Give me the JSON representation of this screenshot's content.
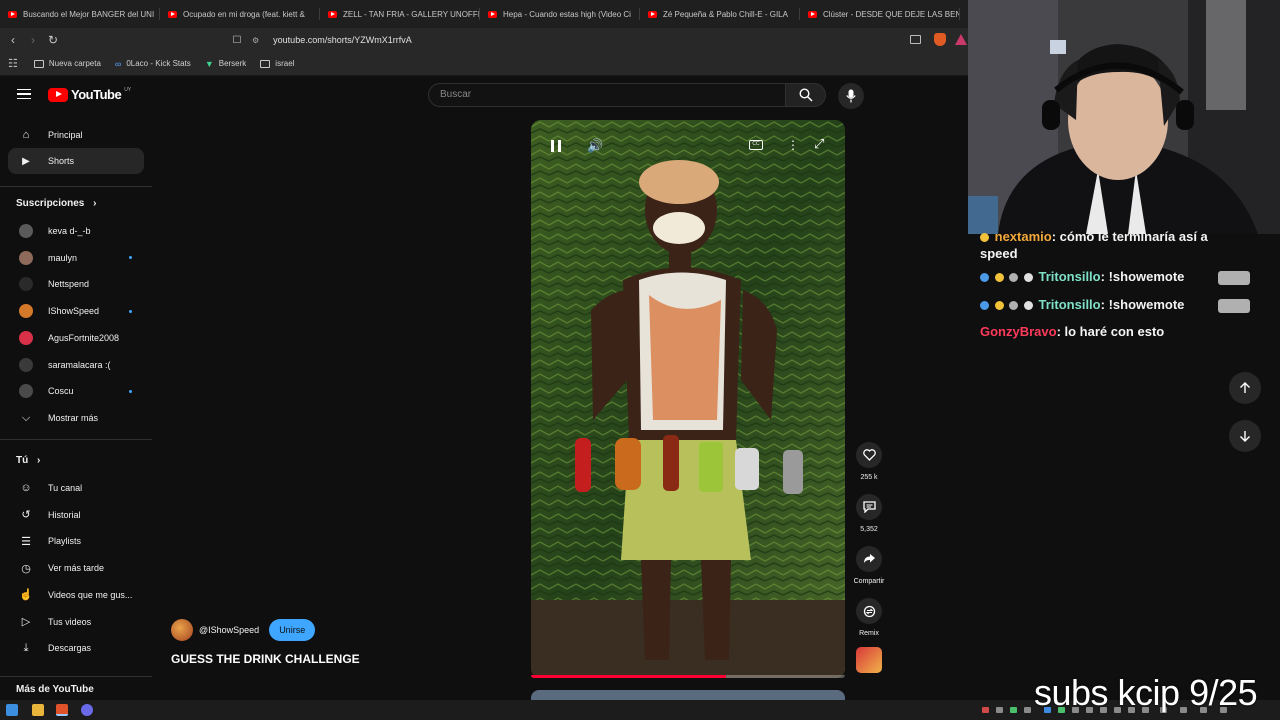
{
  "browser": {
    "tabs": [
      {
        "title": "Buscando el Mejor BANGER del UNI"
      },
      {
        "title": "Ocupado en mi droga (feat. kiett &"
      },
      {
        "title": "ZELL - TAN FRIA - GALLERY UNOFFI"
      },
      {
        "title": "Hepa - Cuando estas high (Video Ci"
      },
      {
        "title": "Zé Pequeña & Pablo Chill-E - GILA"
      },
      {
        "title": "Clúster - DESDE QUE DEJE LAS BEN"
      }
    ],
    "url": "youtube.com/shorts/YZWmX1rrfvA",
    "bookmarks": [
      "Nueva carpeta",
      "0Laco - Kick Stats",
      "Berserk",
      "israel"
    ]
  },
  "youtube": {
    "logo_text": "YouTube",
    "country_code": "UY",
    "search_placeholder": "Buscar",
    "sidebar": {
      "main": [
        {
          "label": "Principal",
          "icon": "home-icon"
        },
        {
          "label": "Shorts",
          "icon": "shorts-icon",
          "active": true
        }
      ],
      "subs_header": "Suscripciones",
      "subscriptions": [
        {
          "label": "keva d-_-b",
          "color": "#5a5a5a",
          "live": false
        },
        {
          "label": "maulyn",
          "color": "#8d6a5a",
          "live": true
        },
        {
          "label": "Nettspend",
          "color": "#2a2a2a",
          "live": false
        },
        {
          "label": "IShowSpeed",
          "color": "#d4782a",
          "live": true
        },
        {
          "label": "AgusFortnite2008",
          "color": "#d9304a",
          "live": false
        },
        {
          "label": "saramalacara :(",
          "color": "#3a3a3a",
          "live": false
        },
        {
          "label": "Coscu",
          "color": "#4a4a4a",
          "live": true
        }
      ],
      "show_more": "Mostrar más",
      "you_header": "Tú",
      "you": [
        {
          "label": "Tu canal",
          "icon": "channel-icon"
        },
        {
          "label": "Historial",
          "icon": "history-icon"
        },
        {
          "label": "Playlists",
          "icon": "playlist-icon"
        },
        {
          "label": "Ver más tarde",
          "icon": "clock-icon"
        },
        {
          "label": "Videos que me gus...",
          "icon": "thumbs-up-icon"
        },
        {
          "label": "Tus videos",
          "icon": "video-icon"
        },
        {
          "label": "Descargas",
          "icon": "download-icon"
        }
      ],
      "more_header": "Más de YouTube"
    },
    "short": {
      "channel": "@IShowSpeed",
      "join_label": "Unirse",
      "title": "GUESS THE DRINK CHALLENGE",
      "likes": "255 k",
      "comments": "5,352",
      "share_label": "Compartir",
      "remix_label": "Remix",
      "progress": 0.62
    }
  },
  "overlay": {
    "chat": [
      {
        "user": "nextamio",
        "user_color": "#f2a83a",
        "message": ": cómo le terminaría así a",
        "cont": "speed"
      },
      {
        "user": "Tritonsillo",
        "user_color": "#7fe0c8",
        "message": ": !showemote"
      },
      {
        "user": "Tritonsillo",
        "user_color": "#7fe0c8",
        "message": ": !showemote"
      },
      {
        "user": "GonzyBravo",
        "user_color": "#ff3a5a",
        "message": ": lo haré con esto"
      }
    ],
    "subs_text": "subs kcip 9/25"
  }
}
